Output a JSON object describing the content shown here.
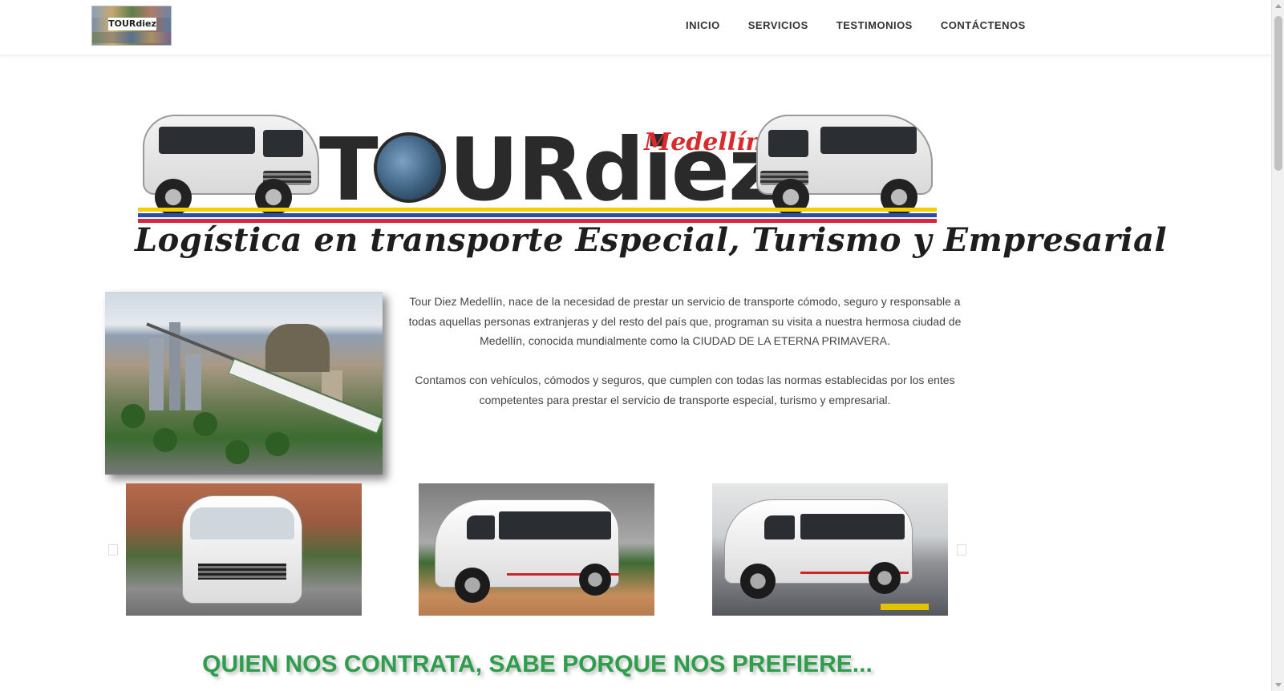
{
  "header": {
    "logo_text": "TOURdiez",
    "nav": [
      "INICIO",
      "SERVICIOS",
      "TESTIMONIOS",
      "CONTÁCTENOS"
    ]
  },
  "banner": {
    "brand": "TOURdiez",
    "city": "Medellín",
    "slogan": "Logística en transporte Especial, Turismo y Empresarial"
  },
  "intro": {
    "paragraph1": "Tour Diez Medellín, nace de la necesidad de prestar un servicio de transporte cómodo, seguro y responsable a todas aquellas personas extranjeras y del resto del país que, programan su visita a nuestra hermosa ciudad de Medellín, conocida mundialmente como la CIUDAD DE LA ETERNA PRIMAVERA.",
    "paragraph2": "Contamos con vehículos, cómodos y seguros, que cumplen con todas las normas establecidas por los entes competentes para prestar el servicio de transporte especial, turismo y empresarial."
  },
  "section_heading": "QUIEN NOS CONTRATA, SABE PORQUE NOS PREFIERE...",
  "colors": {
    "nav_text": "#333333",
    "heading_green": "#2e9e4c",
    "flag_yellow": "#f4d000",
    "flag_blue": "#2c4fa0",
    "flag_red": "#d7263d",
    "city_red": "#d92b2b"
  }
}
